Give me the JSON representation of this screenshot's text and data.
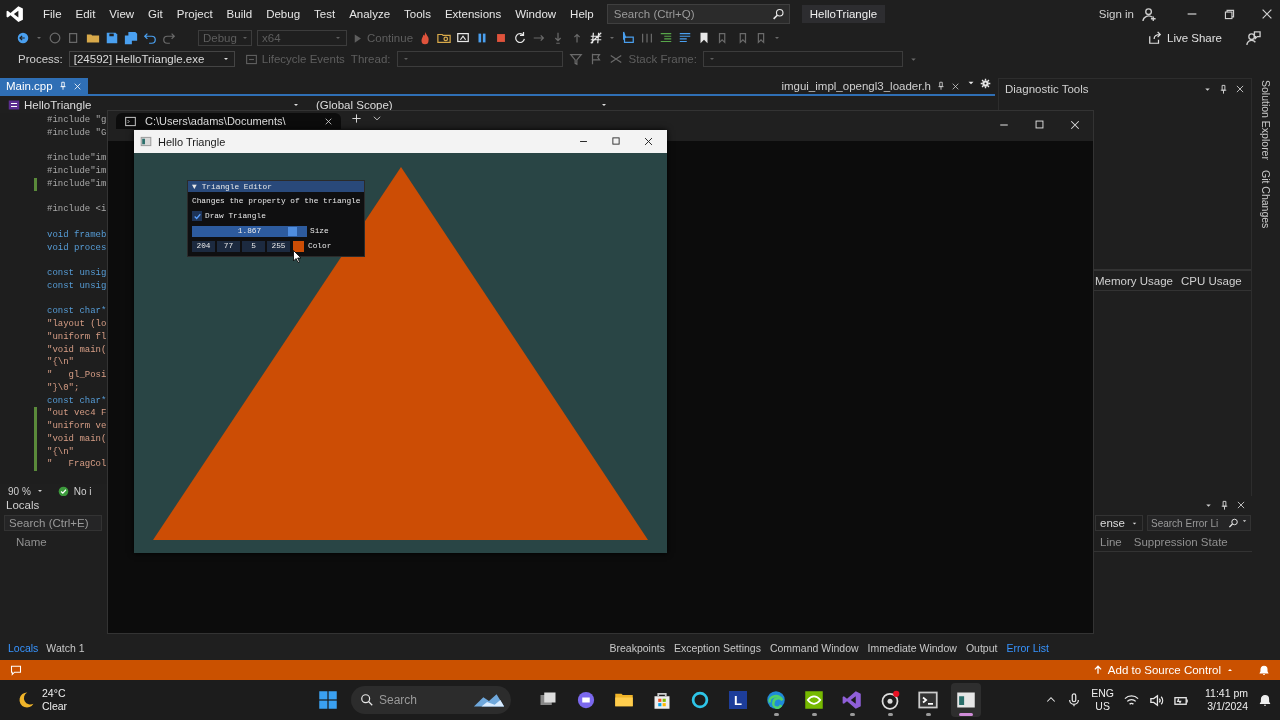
{
  "menu_bar": {
    "items": [
      "File",
      "Edit",
      "View",
      "Git",
      "Project",
      "Build",
      "Debug",
      "Test",
      "Analyze",
      "Tools",
      "Extensions",
      "Window",
      "Help"
    ],
    "search": {
      "placeholder": "Search (Ctrl+Q)"
    },
    "solution_name": "HelloTriangle",
    "sign_in": "Sign in"
  },
  "toolbar": {
    "configuration": {
      "value": "Debug",
      "disabled": true
    },
    "platform": {
      "value": "x64",
      "disabled": true
    },
    "continue": {
      "label": "Continue",
      "disabled": true
    },
    "live_share": "Live Share"
  },
  "debug_location": {
    "process_label": "Process:",
    "process": "[24592] HelloTriangle.exe",
    "lifecycle_events": {
      "label": "Lifecycle Events",
      "disabled": true
    },
    "thread": {
      "label": "Thread:",
      "disabled": true
    },
    "stack_frame": {
      "label": "Stack Frame:",
      "disabled": true
    }
  },
  "editor": {
    "tabs": [
      {
        "label": "Main.cpp",
        "selected": true
      },
      {
        "label": "imgui_impl_opengl3_loader.h",
        "selected": false
      }
    ],
    "project": "HelloTriangle",
    "scope": "(Global Scope)",
    "code_blocks": [
      [
        {
          "text": "#include \"g",
          "kind": "directive",
          "modified": false
        },
        {
          "text": "#include \"G",
          "kind": "directive",
          "modified": false
        }
      ],
      [
        {
          "text": "#include\"im",
          "kind": "directive",
          "modified": false
        },
        {
          "text": "#include\"im",
          "kind": "directive",
          "modified": false
        },
        {
          "text": "#include\"im",
          "kind": "directive",
          "modified": true
        }
      ],
      [
        {
          "text": "#include <i",
          "kind": "directive",
          "modified": false
        }
      ],
      [
        {
          "text": "void frameb",
          "kind": "keyword",
          "modified": false
        },
        {
          "text": "void proces",
          "kind": "keyword",
          "modified": false
        }
      ],
      [
        {
          "text": "const unsig",
          "kind": "keyword",
          "modified": false
        },
        {
          "text": "const unsig",
          "kind": "keyword",
          "modified": false
        }
      ],
      [
        {
          "text": "const char*",
          "kind": "keyword",
          "modified": false
        },
        {
          "text": "\"layout (lo",
          "kind": "string",
          "modified": false
        },
        {
          "text": "\"uniform fl",
          "kind": "string",
          "modified": false
        },
        {
          "text": "\"void main(",
          "kind": "string",
          "modified": false
        },
        {
          "text": "\"{\\n\"",
          "kind": "string",
          "modified": false
        },
        {
          "text": "\"   gl_Posi",
          "kind": "string",
          "modified": false
        },
        {
          "text": "\"}\\0\";",
          "kind": "string",
          "modified": false
        },
        {
          "text": "const char*",
          "kind": "keyword",
          "modified": false
        },
        {
          "text": "\"out vec4 F",
          "kind": "string",
          "modified": true
        },
        {
          "text": "\"uniform ve",
          "kind": "string",
          "modified": true
        },
        {
          "text": "\"void main(",
          "kind": "string",
          "modified": true
        },
        {
          "text": "\"{\\n\"",
          "kind": "string",
          "modified": true
        },
        {
          "text": "\"   FragCol",
          "kind": "string",
          "modified": true
        }
      ]
    ],
    "zoom": "90 %",
    "issues": "No i"
  },
  "diagnostic_tools": {
    "title": "Diagnostic Tools",
    "tabs": [
      "Memory Usage",
      "CPU Usage"
    ]
  },
  "side_tabs": [
    "Solution Explorer",
    "Git Changes"
  ],
  "locals": {
    "title": "Locals",
    "search": {
      "placeholder": "Search (Ctrl+E)"
    },
    "columns": [
      "Name"
    ]
  },
  "error_list": {
    "filter": "ense",
    "search": {
      "placeholder": "Search Error Li"
    },
    "columns": [
      "Line",
      "Suppression State"
    ]
  },
  "bottom_tabs_left": [
    {
      "label": "Locals",
      "selected": true
    },
    {
      "label": "Watch 1",
      "selected": false
    }
  ],
  "bottom_tabs_right": [
    {
      "label": "Breakpoints",
      "selected": false
    },
    {
      "label": "Exception Settings",
      "selected": false
    },
    {
      "label": "Command Window",
      "selected": false
    },
    {
      "label": "Immediate Window",
      "selected": false
    },
    {
      "label": "Output",
      "selected": false
    },
    {
      "label": "Error List",
      "selected": true
    }
  ],
  "status_bar": {
    "source_control": "Add to Source Control"
  },
  "console_window": {
    "tab_title": "C:\\Users\\adams\\Documents\\"
  },
  "app_window": {
    "title": "Hello Triangle",
    "editor_panel": {
      "toggle": "▼",
      "title": "Triangle Editor",
      "description": "Changes the property of the triangle",
      "checkbox": {
        "label": "Draw Triangle",
        "checked": true
      },
      "slider": {
        "value": "1.867",
        "level": 0.91,
        "label": "Size"
      },
      "color_edit": {
        "channels": [
          "204",
          "77",
          "5",
          "255"
        ],
        "color": "#cc4d05",
        "label": "Color"
      }
    }
  },
  "taskbar": {
    "weather": {
      "temperature": "24°C",
      "condition": "Clear"
    },
    "search": {
      "placeholder": "Search"
    },
    "apps": [
      {
        "kind": "task_view",
        "running": false,
        "selected": false
      },
      {
        "kind": "chat",
        "running": false,
        "selected": false
      },
      {
        "kind": "files",
        "running": false,
        "selected": false
      },
      {
        "kind": "store",
        "running": false,
        "selected": false
      },
      {
        "kind": "ring",
        "running": false,
        "selected": false
      },
      {
        "kind": "letter",
        "label": "L",
        "running": false,
        "selected": false
      },
      {
        "kind": "browser",
        "running": true,
        "selected": false
      },
      {
        "kind": "green",
        "running": true,
        "selected": false
      },
      {
        "kind": "ide",
        "running": true,
        "selected": false
      },
      {
        "kind": "recorder",
        "running": true,
        "selected": false
      },
      {
        "kind": "terminal",
        "running": true,
        "selected": false
      },
      {
        "kind": "window",
        "running": true,
        "selected": true
      }
    ],
    "language": "ENG",
    "region": "US",
    "time": "11:41 pm",
    "date": "3/1/2024"
  }
}
